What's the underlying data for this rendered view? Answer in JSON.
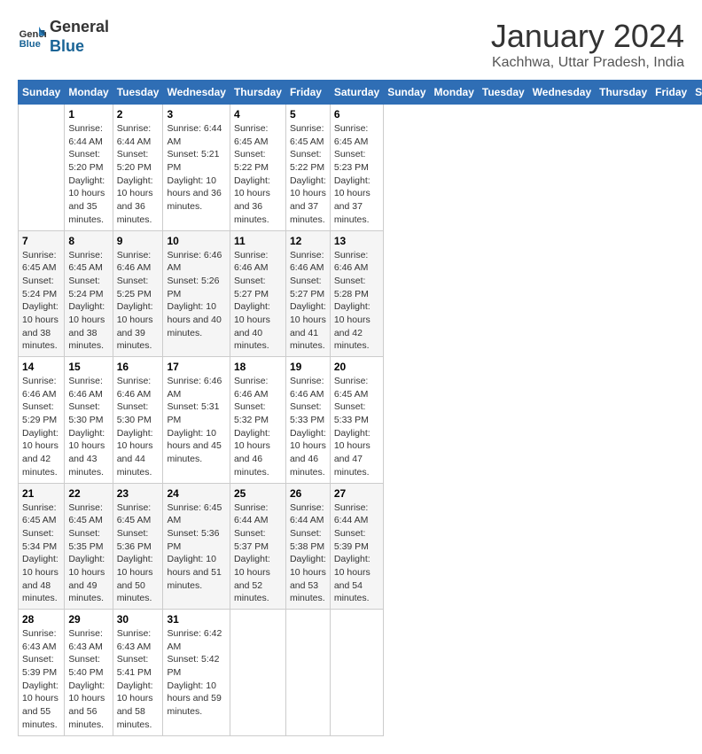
{
  "header": {
    "logo_line1": "General",
    "logo_line2": "Blue",
    "month": "January 2024",
    "location": "Kachhwa, Uttar Pradesh, India"
  },
  "days_of_week": [
    "Sunday",
    "Monday",
    "Tuesday",
    "Wednesday",
    "Thursday",
    "Friday",
    "Saturday"
  ],
  "weeks": [
    [
      {
        "day": "",
        "sunrise": "",
        "sunset": "",
        "daylight": ""
      },
      {
        "day": "1",
        "sunrise": "Sunrise: 6:44 AM",
        "sunset": "Sunset: 5:20 PM",
        "daylight": "Daylight: 10 hours and 35 minutes."
      },
      {
        "day": "2",
        "sunrise": "Sunrise: 6:44 AM",
        "sunset": "Sunset: 5:20 PM",
        "daylight": "Daylight: 10 hours and 36 minutes."
      },
      {
        "day": "3",
        "sunrise": "Sunrise: 6:44 AM",
        "sunset": "Sunset: 5:21 PM",
        "daylight": "Daylight: 10 hours and 36 minutes."
      },
      {
        "day": "4",
        "sunrise": "Sunrise: 6:45 AM",
        "sunset": "Sunset: 5:22 PM",
        "daylight": "Daylight: 10 hours and 36 minutes."
      },
      {
        "day": "5",
        "sunrise": "Sunrise: 6:45 AM",
        "sunset": "Sunset: 5:22 PM",
        "daylight": "Daylight: 10 hours and 37 minutes."
      },
      {
        "day": "6",
        "sunrise": "Sunrise: 6:45 AM",
        "sunset": "Sunset: 5:23 PM",
        "daylight": "Daylight: 10 hours and 37 minutes."
      }
    ],
    [
      {
        "day": "7",
        "sunrise": "Sunrise: 6:45 AM",
        "sunset": "Sunset: 5:24 PM",
        "daylight": "Daylight: 10 hours and 38 minutes."
      },
      {
        "day": "8",
        "sunrise": "Sunrise: 6:45 AM",
        "sunset": "Sunset: 5:24 PM",
        "daylight": "Daylight: 10 hours and 38 minutes."
      },
      {
        "day": "9",
        "sunrise": "Sunrise: 6:46 AM",
        "sunset": "Sunset: 5:25 PM",
        "daylight": "Daylight: 10 hours and 39 minutes."
      },
      {
        "day": "10",
        "sunrise": "Sunrise: 6:46 AM",
        "sunset": "Sunset: 5:26 PM",
        "daylight": "Daylight: 10 hours and 40 minutes."
      },
      {
        "day": "11",
        "sunrise": "Sunrise: 6:46 AM",
        "sunset": "Sunset: 5:27 PM",
        "daylight": "Daylight: 10 hours and 40 minutes."
      },
      {
        "day": "12",
        "sunrise": "Sunrise: 6:46 AM",
        "sunset": "Sunset: 5:27 PM",
        "daylight": "Daylight: 10 hours and 41 minutes."
      },
      {
        "day": "13",
        "sunrise": "Sunrise: 6:46 AM",
        "sunset": "Sunset: 5:28 PM",
        "daylight": "Daylight: 10 hours and 42 minutes."
      }
    ],
    [
      {
        "day": "14",
        "sunrise": "Sunrise: 6:46 AM",
        "sunset": "Sunset: 5:29 PM",
        "daylight": "Daylight: 10 hours and 42 minutes."
      },
      {
        "day": "15",
        "sunrise": "Sunrise: 6:46 AM",
        "sunset": "Sunset: 5:30 PM",
        "daylight": "Daylight: 10 hours and 43 minutes."
      },
      {
        "day": "16",
        "sunrise": "Sunrise: 6:46 AM",
        "sunset": "Sunset: 5:30 PM",
        "daylight": "Daylight: 10 hours and 44 minutes."
      },
      {
        "day": "17",
        "sunrise": "Sunrise: 6:46 AM",
        "sunset": "Sunset: 5:31 PM",
        "daylight": "Daylight: 10 hours and 45 minutes."
      },
      {
        "day": "18",
        "sunrise": "Sunrise: 6:46 AM",
        "sunset": "Sunset: 5:32 PM",
        "daylight": "Daylight: 10 hours and 46 minutes."
      },
      {
        "day": "19",
        "sunrise": "Sunrise: 6:46 AM",
        "sunset": "Sunset: 5:33 PM",
        "daylight": "Daylight: 10 hours and 46 minutes."
      },
      {
        "day": "20",
        "sunrise": "Sunrise: 6:45 AM",
        "sunset": "Sunset: 5:33 PM",
        "daylight": "Daylight: 10 hours and 47 minutes."
      }
    ],
    [
      {
        "day": "21",
        "sunrise": "Sunrise: 6:45 AM",
        "sunset": "Sunset: 5:34 PM",
        "daylight": "Daylight: 10 hours and 48 minutes."
      },
      {
        "day": "22",
        "sunrise": "Sunrise: 6:45 AM",
        "sunset": "Sunset: 5:35 PM",
        "daylight": "Daylight: 10 hours and 49 minutes."
      },
      {
        "day": "23",
        "sunrise": "Sunrise: 6:45 AM",
        "sunset": "Sunset: 5:36 PM",
        "daylight": "Daylight: 10 hours and 50 minutes."
      },
      {
        "day": "24",
        "sunrise": "Sunrise: 6:45 AM",
        "sunset": "Sunset: 5:36 PM",
        "daylight": "Daylight: 10 hours and 51 minutes."
      },
      {
        "day": "25",
        "sunrise": "Sunrise: 6:44 AM",
        "sunset": "Sunset: 5:37 PM",
        "daylight": "Daylight: 10 hours and 52 minutes."
      },
      {
        "day": "26",
        "sunrise": "Sunrise: 6:44 AM",
        "sunset": "Sunset: 5:38 PM",
        "daylight": "Daylight: 10 hours and 53 minutes."
      },
      {
        "day": "27",
        "sunrise": "Sunrise: 6:44 AM",
        "sunset": "Sunset: 5:39 PM",
        "daylight": "Daylight: 10 hours and 54 minutes."
      }
    ],
    [
      {
        "day": "28",
        "sunrise": "Sunrise: 6:43 AM",
        "sunset": "Sunset: 5:39 PM",
        "daylight": "Daylight: 10 hours and 55 minutes."
      },
      {
        "day": "29",
        "sunrise": "Sunrise: 6:43 AM",
        "sunset": "Sunset: 5:40 PM",
        "daylight": "Daylight: 10 hours and 56 minutes."
      },
      {
        "day": "30",
        "sunrise": "Sunrise: 6:43 AM",
        "sunset": "Sunset: 5:41 PM",
        "daylight": "Daylight: 10 hours and 58 minutes."
      },
      {
        "day": "31",
        "sunrise": "Sunrise: 6:42 AM",
        "sunset": "Sunset: 5:42 PM",
        "daylight": "Daylight: 10 hours and 59 minutes."
      },
      {
        "day": "",
        "sunrise": "",
        "sunset": "",
        "daylight": ""
      },
      {
        "day": "",
        "sunrise": "",
        "sunset": "",
        "daylight": ""
      },
      {
        "day": "",
        "sunrise": "",
        "sunset": "",
        "daylight": ""
      }
    ]
  ]
}
